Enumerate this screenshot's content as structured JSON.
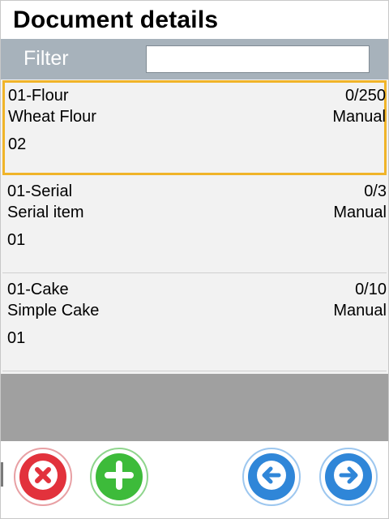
{
  "header": {
    "title": "Document details"
  },
  "filter": {
    "label": "Filter",
    "value": "",
    "placeholder": ""
  },
  "items": [
    {
      "code": "01-Flour",
      "qty": "0/250",
      "description": "Wheat Flour",
      "mode": "Manual",
      "location": "02",
      "selected": true
    },
    {
      "code": "01-Serial",
      "qty": "0/3",
      "description": "Serial item",
      "mode": "Manual",
      "location": "01",
      "selected": false
    },
    {
      "code": "01-Cake",
      "qty": "0/10",
      "description": "Simple Cake",
      "mode": "Manual",
      "location": "01",
      "selected": false
    }
  ],
  "toolbar": {
    "cancel_icon": "close-icon",
    "add_icon": "plus-icon",
    "prev_icon": "arrow-left-icon",
    "next_icon": "arrow-right-icon"
  },
  "colors": {
    "filter_bar": "#a7b2bb",
    "selection": "#f0b429",
    "cancel": "#e2323c",
    "add": "#3dbb3a",
    "nav": "#2f86d8",
    "empty_area": "#a0a0a0"
  }
}
